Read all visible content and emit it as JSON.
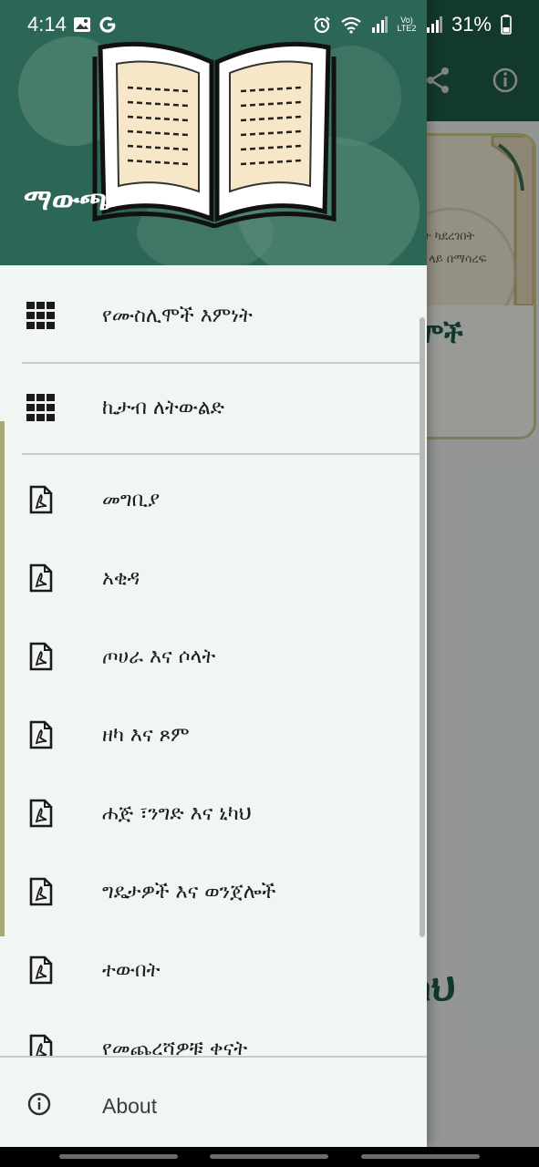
{
  "status_bar": {
    "time": "4:14",
    "notification_icons": [
      "gallery-icon",
      "google-icon"
    ],
    "system_icons": [
      "alarm-icon",
      "wifi-icon",
      "signal-icon",
      "volte-icon",
      "signal-icon"
    ],
    "volte_label": "Vo) LTE2",
    "battery": "31%"
  },
  "background_app": {
    "appbar_actions": [
      "share-icon",
      "info-icon"
    ],
    "card_text_lines": [
      "ናት ካደረገበት",
      "ድ ላይ በማሳረፍ"
    ],
    "card_header_glyph": "ዓ",
    "card_title": "ሞች",
    "bottom_text": "ካህ",
    "accent_color": "#1f5b48"
  },
  "drawer": {
    "title": "ማውጫ",
    "header_color": "#2c6656",
    "categories": [
      {
        "label": "የሙስሊሞች እምነት",
        "icon": "grid-icon"
      },
      {
        "label": "ኪታብ ለትውልድ",
        "icon": "grid-icon"
      }
    ],
    "chapters": [
      {
        "label": "መግቢያ",
        "icon": "pdf-icon"
      },
      {
        "label": "አቂዳ",
        "icon": "pdf-icon"
      },
      {
        "label": "ጦሀራ እና ሶላት",
        "icon": "pdf-icon"
      },
      {
        "label": "ዘካ እና ጾም",
        "icon": "pdf-icon"
      },
      {
        "label": "ሐጅ ፣ንግድ እና ኒካህ",
        "icon": "pdf-icon"
      },
      {
        "label": "ግዴታዎች እና ወንጀሎች",
        "icon": "pdf-icon"
      },
      {
        "label": "ተውበት",
        "icon": "pdf-icon"
      },
      {
        "label": "የመጨረሻዎቹ ቀናት",
        "icon": "pdf-icon"
      }
    ],
    "footer": {
      "label": "About",
      "icon": "info-icon"
    }
  }
}
